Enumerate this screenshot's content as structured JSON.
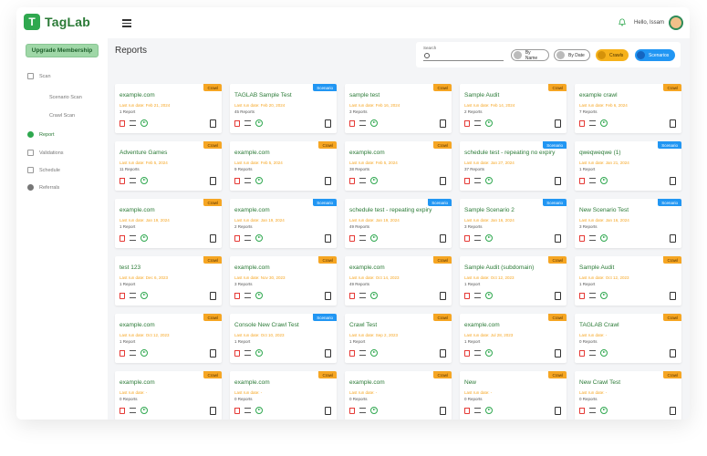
{
  "app": {
    "logo_mark": "T",
    "logo_text": "TagLab",
    "greeting": "Hello, Issam"
  },
  "sidebar": {
    "upgrade_label": "Upgrade Membership",
    "items": [
      {
        "label": "Scan",
        "icon": "scan-icon"
      },
      {
        "label": "Scenario Scan",
        "sub": true
      },
      {
        "label": "Crawl Scan",
        "sub": true
      },
      {
        "label": "Report",
        "icon": "report-icon",
        "active": true
      },
      {
        "label": "Validations",
        "icon": "validations-icon"
      },
      {
        "label": "Schedule",
        "icon": "calendar-icon"
      },
      {
        "label": "Referrals",
        "icon": "referrals-icon"
      }
    ]
  },
  "main": {
    "title": "Reports"
  },
  "filters": {
    "search_label": "Search",
    "search_placeholder": "",
    "by_name": "By Name",
    "by_date": "By Date",
    "crawls": "Crawls",
    "scenarios": "Scenarios"
  },
  "cards": [
    {
      "title": "example.com",
      "date": "Last run date: Feb 21, 2024",
      "count": "1 Report",
      "type": "Crawl"
    },
    {
      "title": "TAGLAB Sample Test",
      "date": "Last run date: Feb 20, 2024",
      "count": "45 Reports",
      "type": "Scenario"
    },
    {
      "title": "sample test",
      "date": "Last run date: Feb 16, 2024",
      "count": "3 Reports",
      "type": "Crawl"
    },
    {
      "title": "Sample Audit",
      "date": "Last run date: Feb 14, 2024",
      "count": "2 Reports",
      "type": "Crawl"
    },
    {
      "title": "example crawl",
      "date": "Last run date: Feb 6, 2024",
      "count": "7 Reports",
      "type": "Crawl"
    },
    {
      "title": "Adventure Games",
      "date": "Last run date: Feb 5, 2024",
      "count": "11 Reports",
      "type": "Crawl"
    },
    {
      "title": "example.com",
      "date": "Last run date: Feb 5, 2024",
      "count": "9 Reports",
      "type": "Crawl"
    },
    {
      "title": "example.com",
      "date": "Last run date: Feb 5, 2024",
      "count": "38 Reports",
      "type": "Crawl"
    },
    {
      "title": "schedule test - repeating no expiry",
      "date": "Last run date: Jan 27, 2024",
      "count": "37 Reports",
      "type": "Scenario"
    },
    {
      "title": "qweqweqwe (1)",
      "date": "Last run date: Jan 21, 2024",
      "count": "1 Report",
      "type": "Scenario"
    },
    {
      "title": "example.com",
      "date": "Last run date: Jan 19, 2024",
      "count": "1 Report",
      "type": "Crawl"
    },
    {
      "title": "example.com",
      "date": "Last run date: Jan 19, 2024",
      "count": "2 Reports",
      "type": "Scenario"
    },
    {
      "title": "schedule test - repeating expiry",
      "date": "Last run date: Jan 19, 2024",
      "count": "49 Reports",
      "type": "Scenario"
    },
    {
      "title": "Sample Scenario 2",
      "date": "Last run date: Jan 16, 2024",
      "count": "3 Reports",
      "type": "Scenario"
    },
    {
      "title": "New Scenario Test",
      "date": "Last run date: Jan 16, 2024",
      "count": "3 Reports",
      "type": "Scenario"
    },
    {
      "title": "test 123",
      "date": "Last run date: Dec 6, 2023",
      "count": "1 Report",
      "type": "Crawl"
    },
    {
      "title": "example.com",
      "date": "Last run date: Nov 30, 2023",
      "count": "3 Reports",
      "type": "Crawl"
    },
    {
      "title": "example.com",
      "date": "Last run date: Oct 14, 2023",
      "count": "49 Reports",
      "type": "Crawl"
    },
    {
      "title": "Sample Audit (subdomain)",
      "date": "Last run date: Oct 12, 2023",
      "count": "1 Report",
      "type": "Crawl"
    },
    {
      "title": "Sample Audit",
      "date": "Last run date: Oct 12, 2023",
      "count": "1 Report",
      "type": "Crawl"
    },
    {
      "title": "example.com",
      "date": "Last run date: Oct 12, 2023",
      "count": "1 Report",
      "type": "Crawl"
    },
    {
      "title": "Console New Crawl Test",
      "date": "Last run date: Oct 10, 2023",
      "count": "1 Report",
      "type": "Scenario"
    },
    {
      "title": "Crawl Test",
      "date": "Last run date: Sep 2, 2023",
      "count": "1 Report",
      "type": "Crawl"
    },
    {
      "title": "example.com",
      "date": "Last run date: Jul 28, 2023",
      "count": "1 Report",
      "type": "Crawl"
    },
    {
      "title": "TAGLAB Crawl",
      "date": "Last run date: -",
      "count": "0 Reports",
      "type": "Crawl"
    },
    {
      "title": "example.com",
      "date": "Last run date: -",
      "count": "0 Reports",
      "type": "Crawl"
    },
    {
      "title": "example.com",
      "date": "Last run date: -",
      "count": "0 Reports",
      "type": "Crawl"
    },
    {
      "title": "example.com",
      "date": "Last run date: -",
      "count": "0 Reports",
      "type": "Crawl"
    },
    {
      "title": "New",
      "date": "Last run date: -",
      "count": "0 Reports",
      "type": "Crawl"
    },
    {
      "title": "New Crawl Test",
      "date": "Last run date: -",
      "count": "0 Reports",
      "type": "Crawl"
    }
  ],
  "colors": {
    "brand_green": "#2fa84f",
    "crawl_orange": "#f6a623",
    "scenario_blue": "#2196f3",
    "delete_red": "#e53935"
  }
}
